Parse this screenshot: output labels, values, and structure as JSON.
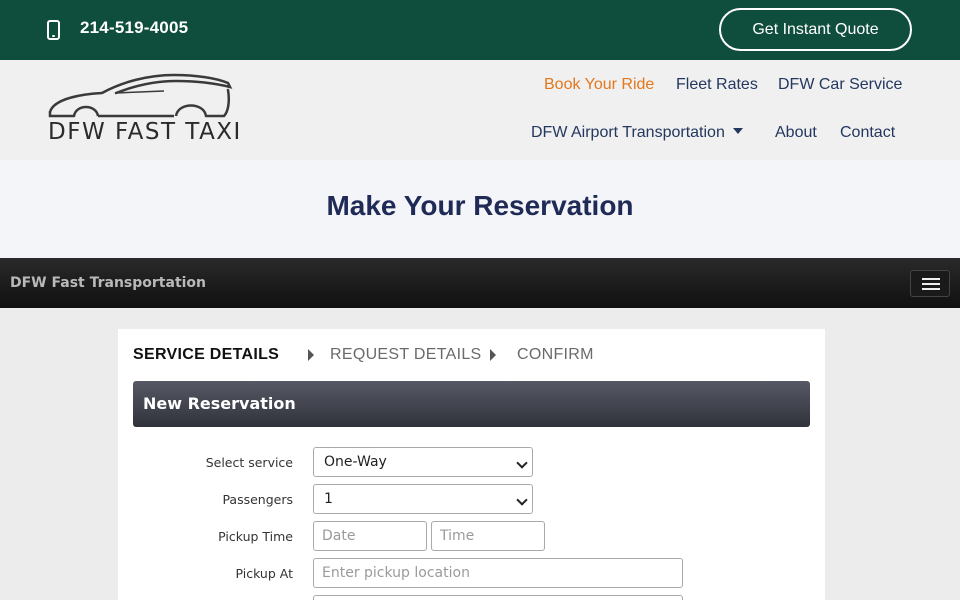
{
  "topbar": {
    "phone": "214-519-4005",
    "quote_button": "Get Instant Quote",
    "background": "#0f4d3d"
  },
  "header": {
    "logo_text": "DFW FAST TAXI",
    "nav": [
      {
        "label": "Book Your Ride",
        "active": true
      },
      {
        "label": "Fleet Rates"
      },
      {
        "label": "DFW Car Service"
      },
      {
        "label": "DFW Airport Transportation",
        "has_dropdown": true
      },
      {
        "label": "About"
      },
      {
        "label": "Contact"
      }
    ],
    "active_color": "#e4771d",
    "nav_color": "#24375f"
  },
  "page_title": "Make Your Reservation",
  "darkbar": {
    "title": "DFW Fast Transportation"
  },
  "steps": [
    {
      "label": "SERVICE DETAILS",
      "current": true
    },
    {
      "label": "REQUEST DETAILS"
    },
    {
      "label": "CONFIRM"
    }
  ],
  "panel_title": "New Reservation",
  "form": {
    "service": {
      "label": "Select service",
      "value": "One-Way"
    },
    "passengers": {
      "label": "Passengers",
      "value": "1"
    },
    "pickup_time": {
      "label": "Pickup Time",
      "date_placeholder": "Date",
      "time_placeholder": "Time"
    },
    "pickup_at": {
      "label": "Pickup At",
      "placeholder": "Enter pickup location"
    }
  }
}
